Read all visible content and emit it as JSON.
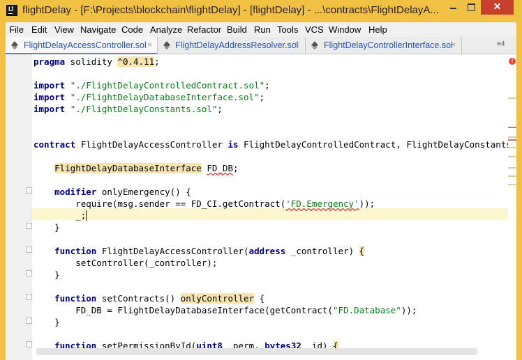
{
  "window": {
    "title": "flightDelay - [F:\\Projects\\blockchain\\flightDelay] - [flightDelay] - ...\\contracts\\FlightDelayA...",
    "app_icon_letter": "IJ",
    "close_glyph": "✕",
    "accent": "#f2c144"
  },
  "menu": {
    "items": [
      "File",
      "Edit",
      "View",
      "Navigate",
      "Code",
      "Analyze",
      "Refactor",
      "Build",
      "Run",
      "Tools",
      "VCS",
      "Window",
      "Help"
    ]
  },
  "tabs": {
    "items": [
      {
        "label": "FlightDelayAccessController.sol",
        "icon": "ethereum-icon",
        "active": true
      },
      {
        "label": "FlightDelayAddressResolver.sol",
        "icon": "ethereum-icon",
        "active": false
      },
      {
        "label": "FlightDelayControllerInterface.sol",
        "icon": "ethereum-icon",
        "active": false
      }
    ],
    "close_glyph": "×",
    "overflow_label": "≡4"
  },
  "editor": {
    "lines": [
      "pragma solidity ^0.4.11;",
      "",
      "import \"./FlightDelayControlledContract.sol\";",
      "import \"./FlightDelayDatabaseInterface.sol\";",
      "import \"./FlightDelayConstants.sol\";",
      "",
      "",
      "contract FlightDelayAccessController is FlightDelayControlledContract, FlightDelayConstants {",
      "",
      "    FlightDelayDatabaseInterface FD_DB;",
      "",
      "    modifier onlyEmergency() {",
      "        require(msg.sender == FD_CI.getContract('FD.Emergency'));",
      "        _;",
      "    }",
      "",
      "    function FlightDelayAccessController(address _controller) {",
      "        setController(_controller);",
      "    }",
      "",
      "    function setContracts() onlyController {",
      "        FD_DB = FlightDelayDatabaseInterface(getContract(\"FD.Database\"));",
      "    }",
      "",
      "    function setPermissionById(uint8 _perm, bytes32 _id) {"
    ],
    "error_mark": "!",
    "colors": {
      "keyword": "#000080",
      "string": "#067d17",
      "highlight": "#f6e5b0",
      "caret_line": "#fdf7cf"
    }
  }
}
